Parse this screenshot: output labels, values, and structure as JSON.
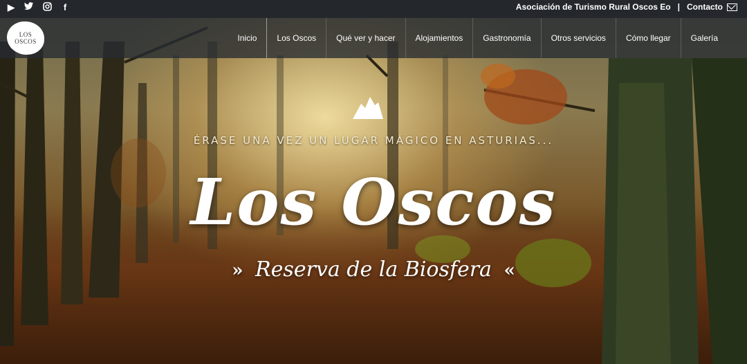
{
  "social": {
    "icons": [
      "youtube-icon",
      "twitter-icon",
      "instagram-icon",
      "facebook-icon"
    ],
    "glyphs": [
      "▶",
      "🐦",
      "◎",
      "f"
    ]
  },
  "topbar": {
    "association": "Asociación de Turismo Rural Oscos Eo",
    "separator": "|",
    "contact": "Contacto"
  },
  "logo": {
    "line1": "LOS",
    "line2": "OSCOS"
  },
  "nav": {
    "items": [
      "Inicio",
      "Los Oscos",
      "Qué ver y hacer",
      "Alojamientos",
      "Gastronomía",
      "Otros servicios",
      "Cómo llegar",
      "Galería"
    ]
  },
  "hero": {
    "tagline": "ÉRASE UNA VEZ UN LUGAR MÁGICO EN ASTURIAS...",
    "title": "Los Oscos",
    "subtitle": "Reserva de la Biosfera",
    "arrow_left": "»",
    "arrow_right": "«"
  },
  "colors": {
    "topbar": "#24282d",
    "navbar": "#262c32",
    "text": "#ffffff"
  }
}
